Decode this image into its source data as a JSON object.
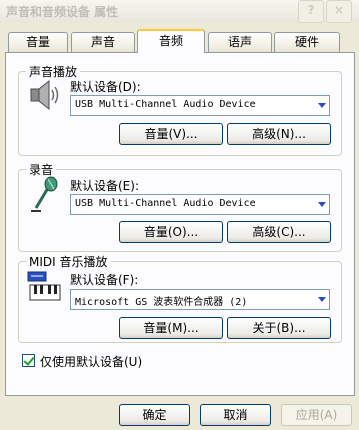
{
  "window": {
    "title": "声音和音频设备 属性",
    "help_glyph": "?",
    "close_glyph": "×"
  },
  "tabs": [
    {
      "label": "音量",
      "active": false
    },
    {
      "label": "声音",
      "active": false
    },
    {
      "label": "音频",
      "active": true
    },
    {
      "label": "语声",
      "active": false
    },
    {
      "label": "硬件",
      "active": false
    }
  ],
  "sound_playback": {
    "title": "声音播放",
    "icon": "speaker-icon",
    "device_label": "默认设备(D):",
    "device_value": "USB Multi-Channel Audio Device",
    "volume_button": "音量(V)...",
    "advanced_button": "高级(N)..."
  },
  "recording": {
    "title": "录音",
    "icon": "microphone-icon",
    "device_label": "默认设备(E):",
    "device_value": "USB Multi-Channel Audio Device",
    "volume_button": "音量(O)...",
    "advanced_button": "高级(C)..."
  },
  "midi": {
    "title": "MIDI 音乐播放",
    "icon": "midi-keyboard-icon",
    "device_label": "默认设备(F):",
    "device_value": "Microsoft GS 波表软件合成器 (2)",
    "volume_button": "音量(M)...",
    "about_button": "关于(B)..."
  },
  "only_default": {
    "label": "仅使用默认设备(U)",
    "checked": true
  },
  "footer": {
    "ok": "确定",
    "cancel": "取消",
    "apply": "应用(A)"
  },
  "colors": {
    "dialog_bg": "#ECE9D8",
    "panel_bg": "#FCFCFE",
    "active_tab_accent": "#FFC83C",
    "combo_border": "#7F9DB9",
    "button_border": "#003C74"
  }
}
